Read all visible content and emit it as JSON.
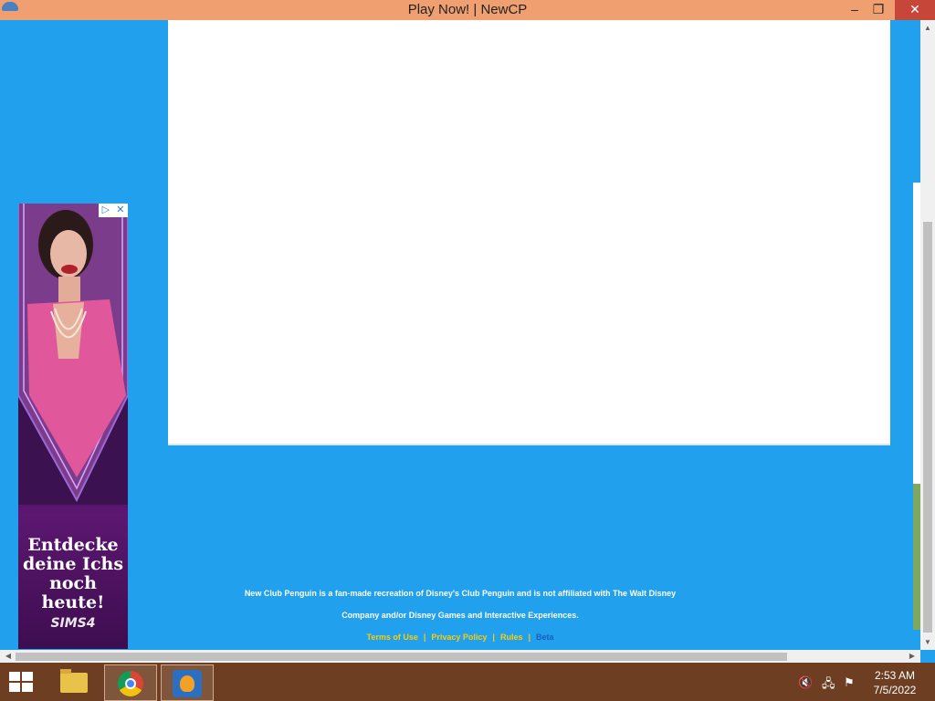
{
  "window": {
    "title": "Play Now! | NewCP",
    "minimize_glyph": "–",
    "maximize_glyph": "❐",
    "close_glyph": "✕"
  },
  "ad": {
    "adchoices_play": "▷",
    "adchoices_close": "✕",
    "headline": "Entdecke deine Ichs noch heute!",
    "brand": "SIMS4"
  },
  "footer": {
    "line1": "New Club Penguin is a fan-made recreation of Disney's Club Penguin and is not affiliated with The Walt Disney",
    "line2": "Company and/or Disney Games and Interactive Experiences.",
    "links": [
      {
        "label": "Terms of Use"
      },
      {
        "label": "Privacy Policy"
      },
      {
        "label": "Rules"
      },
      {
        "label": "Beta"
      }
    ],
    "separator": "|"
  },
  "scrollbars": {
    "up": "▲",
    "down": "▼",
    "left": "◀",
    "right": "▶"
  },
  "taskbar": {
    "clock_time": "2:53 AM",
    "clock_date": "7/5/2022",
    "tray_volume": "🔇",
    "tray_network": "🖧",
    "tray_flag": "⚑"
  },
  "colors": {
    "page_bg": "#21a0ee",
    "titlebar": "#f0a070",
    "link": "#ffcc00",
    "beta_link": "#1c5fb8",
    "taskbar": "#6e3e22"
  }
}
